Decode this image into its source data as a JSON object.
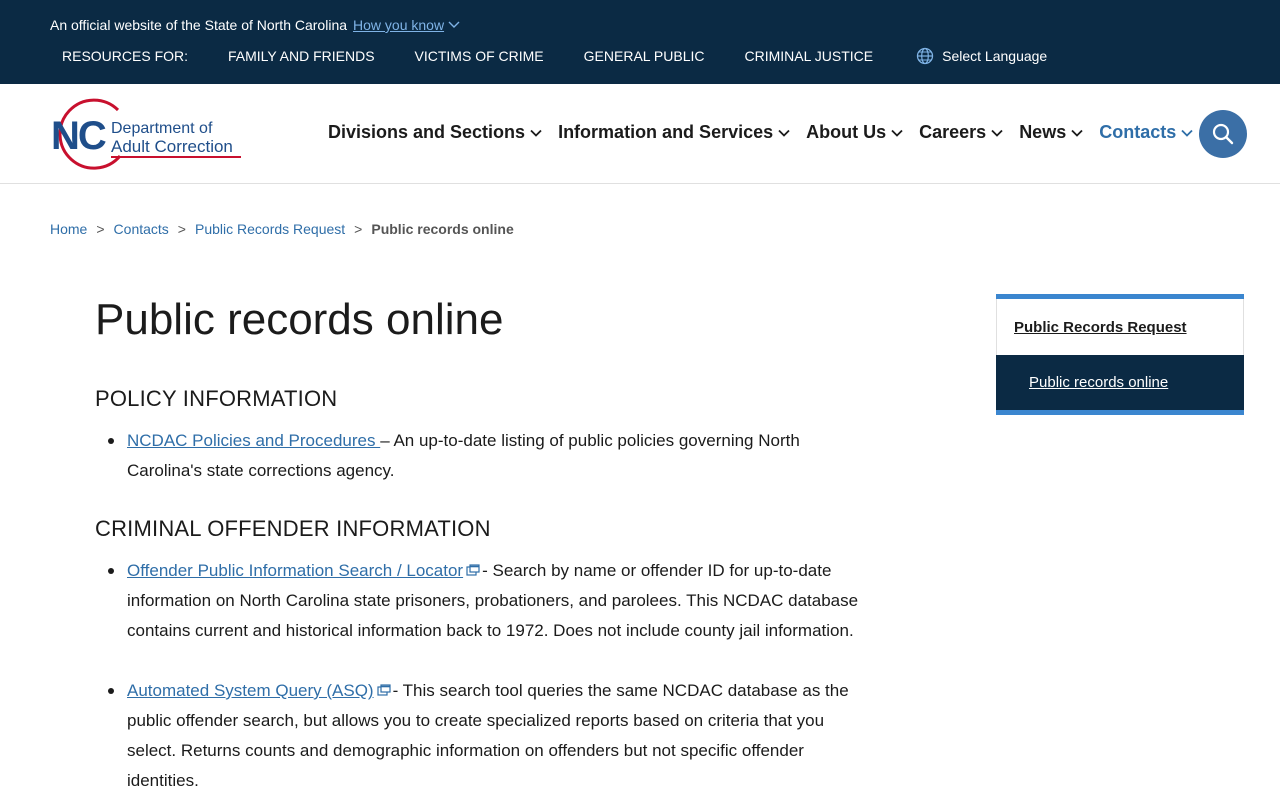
{
  "banner": {
    "official_text": "An official website of the State of North Carolina",
    "how_you_know": "How you know"
  },
  "resources": {
    "label": "RESOURCES FOR:",
    "links": [
      "FAMILY AND FRIENDS",
      "VICTIMS OF CRIME",
      "GENERAL PUBLIC",
      "CRIMINAL JUSTICE"
    ],
    "language": "Select Language"
  },
  "logo": {
    "abbr": "NC",
    "line1": "Department of",
    "line2": "Adult Correction"
  },
  "nav": {
    "items": [
      "Divisions and Sections",
      "Information and Services",
      "About Us",
      "Careers",
      "News",
      "Contacts"
    ],
    "active": "Contacts"
  },
  "breadcrumb": {
    "items": [
      "Home",
      "Contacts",
      "Public Records Request"
    ],
    "current": "Public records online",
    "separator": ">"
  },
  "page": {
    "title": "Public records online",
    "sections": [
      {
        "heading": "POLICY INFORMATION",
        "items": [
          {
            "link": "NCDAC Policies and Procedures ",
            "text": " – An up-to-date listing of public policies governing North Carolina's state corrections agency."
          }
        ]
      },
      {
        "heading": "CRIMINAL OFFENDER INFORMATION",
        "items": [
          {
            "link": "Offender Public Information Search / Locator",
            "text": "- Search by name or offender ID for up-to-date information on North Carolina state prisoners, probationers, and parolees. This NCDAC database contains current and historical information back to 1972. Does not include county jail information."
          },
          {
            "link": "Automated System Query (ASQ)",
            "text": "- This search tool queries the same NCDAC database as the public offender search, but allows you to create specialized reports based on criteria that you select.  Returns counts and demographic information on offenders but not specific offender identities."
          }
        ]
      }
    ]
  },
  "sidenav": {
    "parent": "Public Records Request",
    "child": "Public records online"
  },
  "colors": {
    "banner_bg": "#0b2a44",
    "link": "#2f6ea8",
    "accent": "#3b86cf",
    "logo_blue": "#1f4e8a",
    "logo_red": "#c8102e"
  }
}
